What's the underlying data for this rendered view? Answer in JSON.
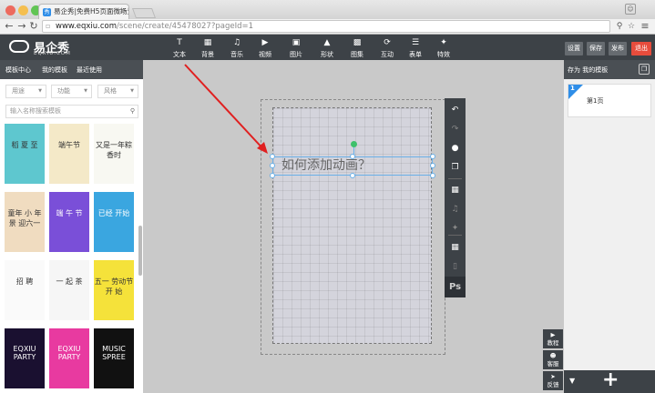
{
  "browser": {
    "tab_title": "易企秀|免费H5页面微场景",
    "tab_favicon": "秀",
    "url_domain": "www.eqxiu.com",
    "url_path": "/scene/create/45478027?pageId=1"
  },
  "header": {
    "logo_name": "易企秀",
    "logo_domain": "EQXIU.COM",
    "tools": [
      {
        "icon": "text-icon",
        "glyph": "T",
        "label": "文本"
      },
      {
        "icon": "background-icon",
        "glyph": "▦",
        "label": "背景"
      },
      {
        "icon": "music-icon",
        "glyph": "♫",
        "label": "音乐"
      },
      {
        "icon": "video-icon",
        "glyph": "▶",
        "label": "视频"
      },
      {
        "icon": "image-icon",
        "glyph": "▣",
        "label": "图片"
      },
      {
        "icon": "shape-icon",
        "glyph": "▲",
        "label": "形状"
      },
      {
        "icon": "gallery-icon",
        "glyph": "▩",
        "label": "图集"
      },
      {
        "icon": "interact-icon",
        "glyph": "⟳",
        "label": "互动"
      },
      {
        "icon": "form-icon",
        "glyph": "☰",
        "label": "表单"
      },
      {
        "icon": "effects-icon",
        "glyph": "✦",
        "label": "特效"
      }
    ],
    "buttons": {
      "settings": "设置",
      "save": "保存",
      "publish": "发布",
      "exit": "退出"
    },
    "colors": {
      "bar": "#3d4247",
      "exit": "#e74c3c",
      "accent": "#2f8ee8"
    }
  },
  "left": {
    "tabs": [
      "模板中心",
      "我的模板",
      "最近使用"
    ],
    "filters": [
      "用途",
      "功能",
      "风格"
    ],
    "search_placeholder": "输入名称搜索模板",
    "thumbs": [
      {
        "text": "稻 夏 至",
        "bg": "#5ec7cf"
      },
      {
        "text": "端午节",
        "bg": "#f4e9c8"
      },
      {
        "text": "又是一年粽香时",
        "bg": "#f8f8f2"
      },
      {
        "text": "童年 小 年 景 迎六一",
        "bg": "#f0dcc0"
      },
      {
        "text": "端 午 节",
        "bg": "#7a4fd8"
      },
      {
        "text": "已经 开始",
        "bg": "#3aa6e0"
      },
      {
        "text": "招 聘",
        "bg": "#fafafa"
      },
      {
        "text": "一 起 茶",
        "bg": "#f6f6f6"
      },
      {
        "text": "五一 劳动节 开 始",
        "bg": "#f5e23a"
      },
      {
        "text": "EQXIU PARTY",
        "bg": "#1a1030"
      },
      {
        "text": "EQXIU PARTY",
        "bg": "#e83aa0"
      },
      {
        "text": "MUSIC SPREE",
        "bg": "#111111"
      }
    ]
  },
  "canvas": {
    "text": "如何添加动画？"
  },
  "vtools": [
    {
      "icon": "undo-icon",
      "glyph": "↶"
    },
    {
      "icon": "redo-icon",
      "glyph": "↷"
    },
    {
      "icon": "preview-icon",
      "glyph": "●"
    },
    {
      "icon": "copy-icon",
      "glyph": "❐"
    },
    {
      "icon": "grid-icon",
      "glyph": "▦"
    },
    {
      "icon": "music-icon",
      "glyph": "♫"
    },
    {
      "icon": "magic-icon",
      "glyph": "✦"
    },
    {
      "icon": "table-icon",
      "glyph": "▦"
    },
    {
      "icon": "phone-icon",
      "glyph": "▯"
    }
  ],
  "ps_label": "Ps",
  "right": {
    "header": "存为 我的模板",
    "page_num": "1",
    "page_label": "第1页"
  },
  "side_buttons": [
    {
      "icon": "tutorial-icon",
      "glyph": "▶",
      "label": "教程"
    },
    {
      "icon": "service-icon",
      "glyph": "☻",
      "label": "客服"
    },
    {
      "icon": "feedback-icon",
      "glyph": "➤",
      "label": "反馈"
    }
  ]
}
